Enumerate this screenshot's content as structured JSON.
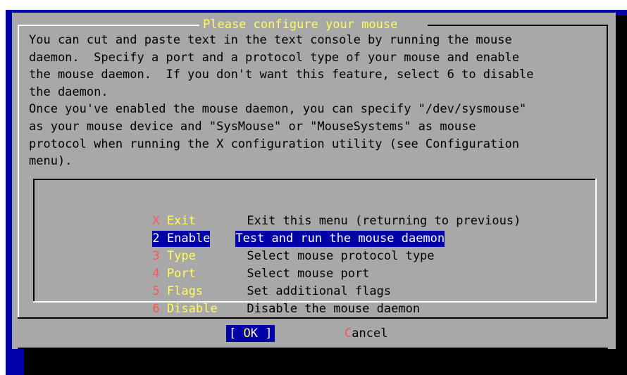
{
  "dialog": {
    "title": "Please configure your mouse",
    "description": "You can cut and paste text in the text console by running the mouse\ndaemon.  Specify a port and a protocol type of your mouse and enable\nthe mouse daemon.  If you don't want this feature, select 6 to disable\nthe daemon.\nOnce you've enabled the mouse daemon, you can specify \"/dev/sysmouse\"\nas your mouse device and \"SysMouse\" or \"MouseSystems\" as mouse\nprotocol when running the X configuration utility (see Configuration\nmenu)."
  },
  "menu": {
    "selected_index": 1,
    "items": [
      {
        "hotkey": "X",
        "tag_rest": " Exit",
        "description": "Exit this menu (returning to previous)"
      },
      {
        "hotkey": "2",
        "tag_rest": " Enable",
        "description": "Test and run the mouse daemon"
      },
      {
        "hotkey": "3",
        "tag_rest": " Type",
        "description": "Select mouse protocol type"
      },
      {
        "hotkey": "4",
        "tag_rest": " Port",
        "description": "Select mouse port"
      },
      {
        "hotkey": "5",
        "tag_rest": " Flags",
        "description": "Set additional flags"
      },
      {
        "hotkey": "6",
        "tag_rest": " Disable",
        "description": "Disable the mouse daemon"
      }
    ]
  },
  "buttons": {
    "ok": {
      "left": "[ ",
      "hotkey": "O",
      "rest": "K ",
      "right": "]"
    },
    "cancel": {
      "hotkey": "C",
      "rest": "ancel"
    }
  },
  "colors": {
    "background": "#0000a8",
    "dialog": "#a8a8a8",
    "title": "#ffff54",
    "hotkey": "#fe5454",
    "selection": "#0000a8"
  }
}
